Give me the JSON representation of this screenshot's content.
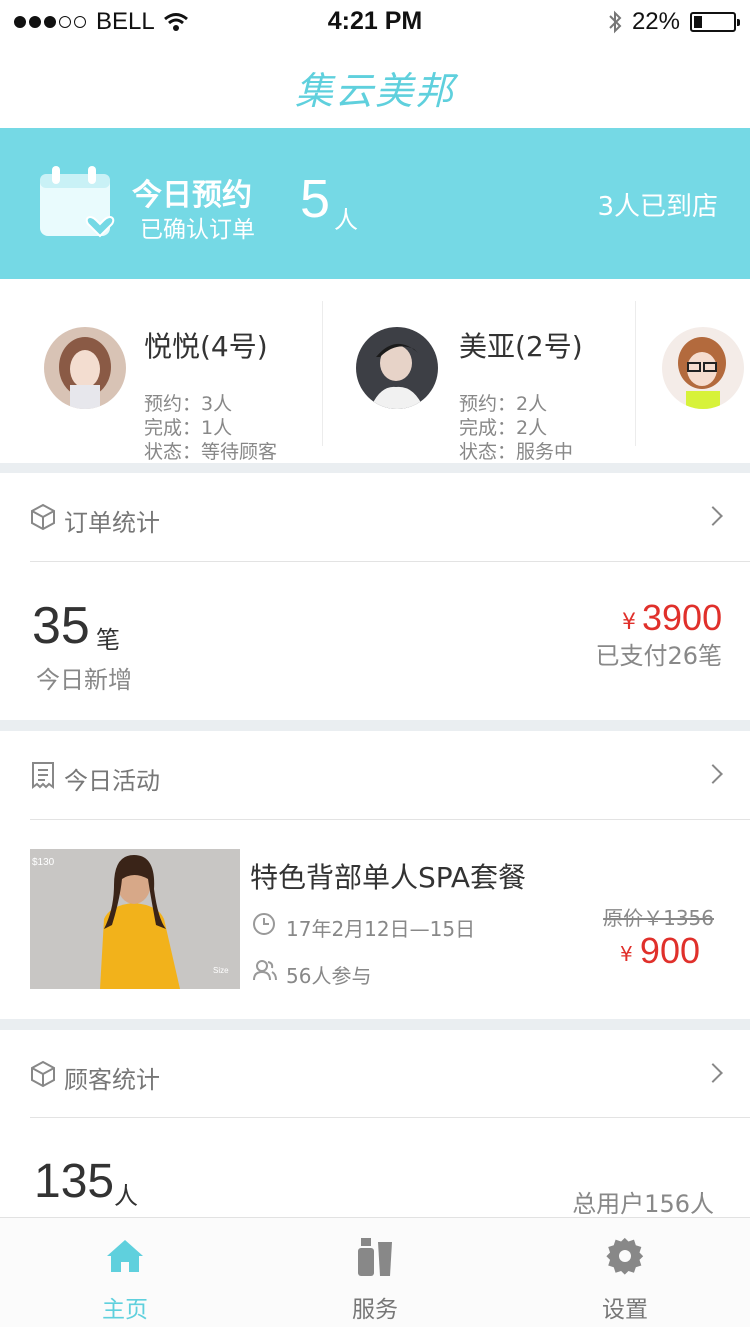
{
  "status_bar": {
    "carrier": "BELL",
    "time": "4:21 PM",
    "battery": "22%",
    "battery_level": 0.22,
    "signal_bars_filled": 3,
    "signal_bars_total": 5
  },
  "header": {
    "logo_text": "集云美邦"
  },
  "banner": {
    "title": "今日预约",
    "subtitle": "已确认订单",
    "count": "5",
    "count_unit": "人",
    "arrived": "3人已到店",
    "background": "#75d9e5"
  },
  "staff": [
    {
      "name": "悦悦(4号)",
      "booked": "预约：3人",
      "done": "完成：1人",
      "status": "状态：等待顾客"
    },
    {
      "name": "美亚(2号)",
      "booked": "预约：2人",
      "done": "完成：2人",
      "status": "状态：服务中"
    }
  ],
  "orders": {
    "label": "订单统计",
    "count": "35",
    "count_unit": "笔",
    "count_caption": "今日新增",
    "currency": "¥",
    "amount": "3900",
    "paid": "已支付26笔"
  },
  "activity": {
    "label": "今日活动",
    "image_tag_price": "$130",
    "image_tag_size": "Size",
    "title": "特色背部单人SPA套餐",
    "date": "17年2月12日—15日",
    "participants": "56人参与",
    "original_price": "原价￥1356",
    "currency": "¥",
    "price": "900"
  },
  "customers": {
    "label": "顾客统计",
    "count": "135",
    "count_unit": "人",
    "total": "总用户156人"
  },
  "tabs": [
    {
      "label": "主页",
      "icon": "home-icon",
      "active": true
    },
    {
      "label": "服务",
      "icon": "products-icon",
      "active": false
    },
    {
      "label": "设置",
      "icon": "gear-icon",
      "active": false
    }
  ],
  "colors": {
    "accent": "#5fd0dd",
    "price_red": "#e0302b",
    "divider": "#eaeef1"
  }
}
